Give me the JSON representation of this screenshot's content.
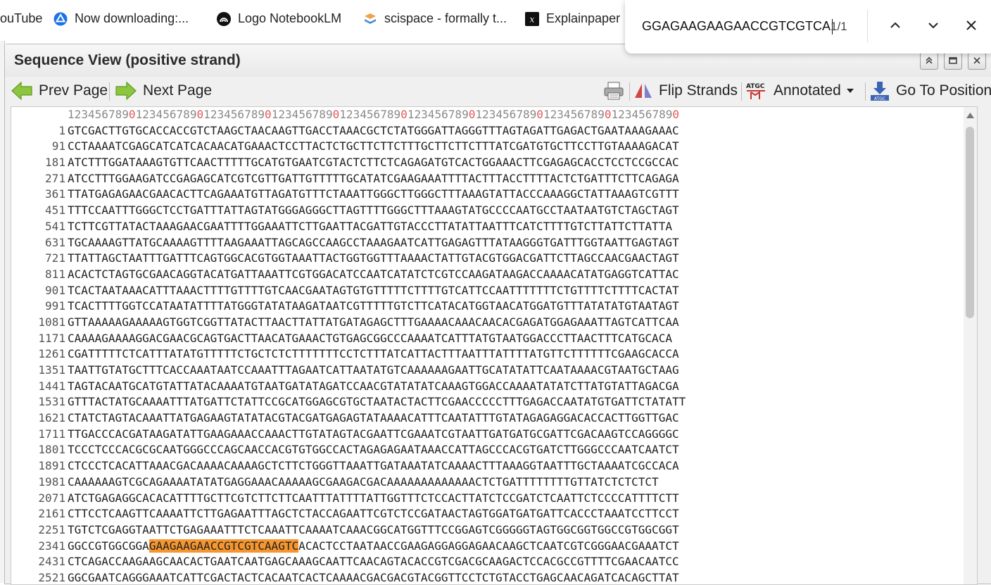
{
  "bookmarks": [
    {
      "label": "ouTube",
      "icon": "youtube-icon"
    },
    {
      "label": "Now downloading:...",
      "icon": "drive-icon"
    },
    {
      "label": "Logo NotebookLM",
      "icon": "notebooklm-icon"
    },
    {
      "label": "scispace - formally t...",
      "icon": "scispace-icon"
    },
    {
      "label": "Explainpaper",
      "icon": "explainpaper-icon"
    }
  ],
  "find": {
    "query": "GGAGAAGAAGAACCGTCGTCA",
    "count": "1/1"
  },
  "window": {
    "title": "Sequence View (positive strand)"
  },
  "toolbar": {
    "prev": "Prev Page",
    "next": "Next Page",
    "flip": "Flip Strands",
    "annotated": "Annotated",
    "goto": "Go To Position"
  },
  "ruler": "123456789012345678901234567890123456789012345678901234567890123456789012345678901234567890",
  "highlight": {
    "row": 26,
    "start": 13,
    "length": 22,
    "color": "#f6962f"
  },
  "rows": [
    {
      "n": "1",
      "s": "GTCGACTTGTGCACCACCGTCTAAGCTAACAAGTTGACCTAAACGCTCTATGGGATTAGGGTTTAGTAGATTGAGACTGAATAAAGAAAC"
    },
    {
      "n": "91",
      "s": "CCTAAAATCGAGCATCATCACAACATGAAACTCCTTACTCTGCTTCTTCTTTGCTTCTTCTTTATCGATGTGCTTCCTTGTAAAAGACAT"
    },
    {
      "n": "181",
      "s": "ATCTTTGGATAAAGTGTTCAACTTTTTGCATGTGAATCGTACTCTTCTCAGAGATGTCACTGGAAACTTCGAGAGCACCTCCTCCGCCAC"
    },
    {
      "n": "271",
      "s": "ATCCTTTGGAAGATCCGAGAGCATCGTCGTTGATTGTTTTTGCATATCGAAGAAATTTTACTTTACCTTTTACTCTGATTTCTTCAGAGA"
    },
    {
      "n": "361",
      "s": "TTATGAGAGAACGAACACTTCAGAAATGTTAGATGTTTCTAAATTGGGCTTGGGCTTTAAAGTATTACCCAAAGGCTATTAAAGTCGTTT"
    },
    {
      "n": "451",
      "s": "TTTCCAATTTGGGCTCCTGATTTATTAGTATGGGAGGGCTTAGTTTTGGGCTTTAAAGTATGCCCCAATGCCTAATAATGTCTAGCTAGT"
    },
    {
      "n": "541",
      "s": "TCTTCGTTATACTAAAGAACGAATTTTGGAAATTCTTGAATTACGATTGTACCCTTATATTAATTTCATCTTTTGTCTTATTCTTATTA"
    },
    {
      "n": "631",
      "s": "TGCAAAAGTTATGCAAAAGTTTTAAGAAATTAGCAGCCAAGCCTAAAGAATCATTGAGAGTTTATAAGGGTGATTTGGTAATTGAGTAGT"
    },
    {
      "n": "721",
      "s": "TTATTAGCTAATTTGATTTCAGTGGCACGTGGTAAATTACTGGTGGTTTAAAACTATTGTACGTGGACGATTCTTAGCCAACGAACTAGT"
    },
    {
      "n": "811",
      "s": "ACACTCTAGTGCGAACAGGTACATGATTAAATTCGTGGACATCCAATCATATCTCGTCCAAGATAAGACCAAAACATATGAGGTCATTAC"
    },
    {
      "n": "901",
      "s": "TCACTAATAAACATTTAAACTTTTGTTTTGTCAACGAATAGTGTGTTTTTCTTTTGTCATTCCAATTTTTTTCTGTTTTCTTTTCACTAT"
    },
    {
      "n": "991",
      "s": "TCACTTTTGGTCCATAATATTTTATGGGTATATAAGATAATCGTTTTTGTCTTCATACATGGTAACATGGATGTTTATATATGTAATAGT"
    },
    {
      "n": "1081",
      "s": "GTTAAAAAGAAAAAGTGGTCGGTTATACTTAACTTATTATGATAGAGCTTTGAAAACAAACAACACGAGATGGAGAAATTAGTCATTCAA"
    },
    {
      "n": "1171",
      "s": "CAAAAGAAAAGGACGAACGCAGTGACTTAACATGAAACTGTGAGCGGCCCAAAATCATTTATGTAATGGACCCTTAACTTTCATGCACA"
    },
    {
      "n": "1261",
      "s": "CGATTTTTCTCATTTATATGTTTTTCTGCTCTCTTTTTTTCCTCTTTATCATTACTTTAATTTATTTTATGTTCTTTTTTCGAAGCACCA"
    },
    {
      "n": "1351",
      "s": "TAATTGTATGCTTTCACCAAATAATCCAAATTTAGAATCATTAATATGTCAAAAAAGAATTGCATATATTCAATAAAACGTAATGCTAAG"
    },
    {
      "n": "1441",
      "s": "TAGTACAATGCATGTATTATACAAAATGTAATGATATAGATCCAACGTATATATCAAAGTGGACCAAAATATATCTTATGTATTAGACGA"
    },
    {
      "n": "1531",
      "s": "GTTTACTATGCAAAATTTATGATTCTATTCCGCATGGAGCGTGCTAATACTACTTCGAACCCCCTTTGAGACCAATATGTGATTCTATATT"
    },
    {
      "n": "1621",
      "s": "CTATCTAGTACAAATTATGAGAAGTATATACGTACGATGAGAGTATAAAACATTTCAATATTTGTATAGAGAGGACACCACTTGGTTGAC"
    },
    {
      "n": "1711",
      "s": "TTGACCCACGATAAGATATTGAAGAAACCAAACTTGTATAGTACGAATTCGAAATCGTAATTGATGATGCGATTCGACAAGTCCAGGGGC"
    },
    {
      "n": "1801",
      "s": "TCCCTCCCACGCGCAATGGGCCCAGCAACCACGTGTGGCCACTAGAGAGAATAAACCATTAGCCCACGTGATCTTGGGCCCAATCAATCT"
    },
    {
      "n": "1891",
      "s": "CTCCCTCACATTAAACGACAAAACAAAAGCTCTTCTGGGTTAAATTGATAAATATCAAAACTTTAAAGGTAATTTGCTAAAATCGCCACA"
    },
    {
      "n": "1981",
      "s": "CAAAAAAGTCGCAGAAAATATATGAGGAAACAAAAAGCGAAGACGACAAAAAAAAAAAAACTCTGATTTTTTTTGTTATCTCTCTCT"
    },
    {
      "n": "2071",
      "s": "ATCTGAGAGGCACACATTTTGCTTCGTCTTCTTCAATTTATTTTATTGGTTTCTCCACTTATCTCCGATCTCAATTCTCCCCATTTTCTT"
    },
    {
      "n": "2161",
      "s": "CTTCCTCAAGTTCAAAATTCTTGAGAATTTAGCTCTACCAGAATTCGTCTCCGATAACTAGTGGATGATGATTCACCCTAAATCCTTCCT"
    },
    {
      "n": "2251",
      "s": "TGTCTCGAGGTAATTCTGAGAAATTTCTCAAATTCAAAATCAAACGGCATGGTTTCCGGAGTCGGGGGTAGTGGCGGTGGCCGTGGCGGT"
    },
    {
      "n": "2341",
      "s": "GGCCGTGGCGGAGAAGAAGAACCGTCGTCAAGTCACACTCCTAATAACCGAAGAGGAGGAGAACAAGCTCAATCGTCGGGAACGAAATCT"
    },
    {
      "n": "2431",
      "s": "CTCAGACCAAGAAGCAACACTGAATCAATGAGCAAAGCAATTCAACAGTACACCGTCGACGCAAGACTCCACGCCGTTTTCGAACAATCC"
    },
    {
      "n": "2521",
      "s": "GGCGAATCAGGGAAATCATTCGACTACTCACAATCACTCAAAACGACGACGTACGGTTCCTCTGTACCTGAGCAACAGATCACAGCTTAT"
    }
  ]
}
